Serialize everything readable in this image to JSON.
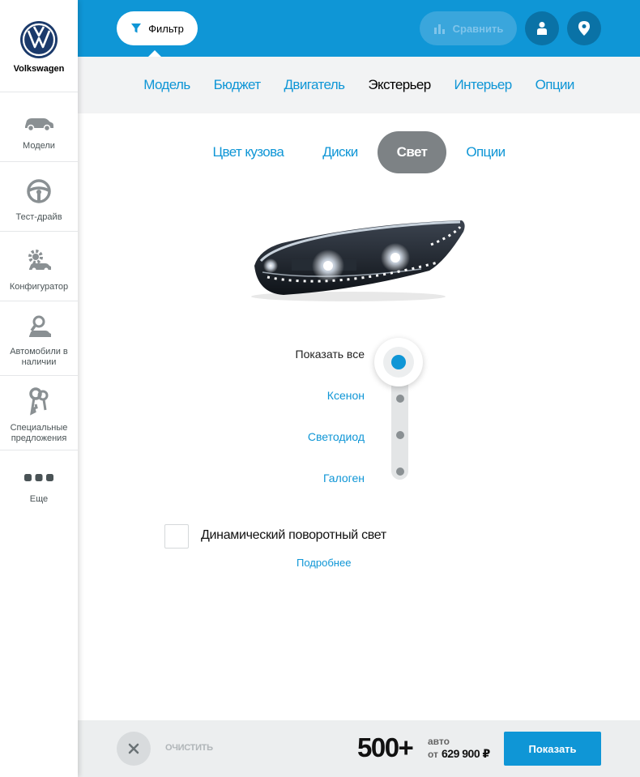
{
  "sidebar": {
    "brand": "Volkswagen",
    "items": [
      {
        "label": "Модели",
        "icon": "car-icon"
      },
      {
        "label": "Тест-драйв",
        "icon": "steering-wheel-icon"
      },
      {
        "label": "Конфигуратор",
        "icon": "configurator-icon"
      },
      {
        "label": "Автомобили в наличии",
        "icon": "car-search-icon"
      },
      {
        "label": "Специальные предложения",
        "icon": "keys-icon"
      },
      {
        "label": "Еще",
        "icon": "more-dots-icon"
      }
    ]
  },
  "header": {
    "filter_label": "Фильтр",
    "compare_label": "Сравнить"
  },
  "main_tabs": [
    "Модель",
    "Бюджет",
    "Двигатель",
    "Экстерьер",
    "Интерьер",
    "Опции"
  ],
  "main_tabs_active": "Экстерьер",
  "sub_tabs": [
    "Цвет кузова",
    "Диски",
    "Свет",
    "Опции"
  ],
  "sub_tabs_active": "Свет",
  "light_options": {
    "show_all": "Показать все",
    "options": [
      "Ксенон",
      "Светодиод",
      "Галоген"
    ],
    "selected": "Показать все"
  },
  "dynamic_light": {
    "label": "Динамический поворотный свет",
    "checked": false,
    "more_link": "Подробнее"
  },
  "footer": {
    "clear_label": "ОЧИСТИТЬ",
    "count": "500+",
    "count_unit": "авто",
    "price_prefix": "от",
    "price": "629 900 ₽",
    "show_label": "Показать"
  },
  "colors": {
    "accent": "#0f96d6",
    "active_tab": "#7d8285"
  }
}
